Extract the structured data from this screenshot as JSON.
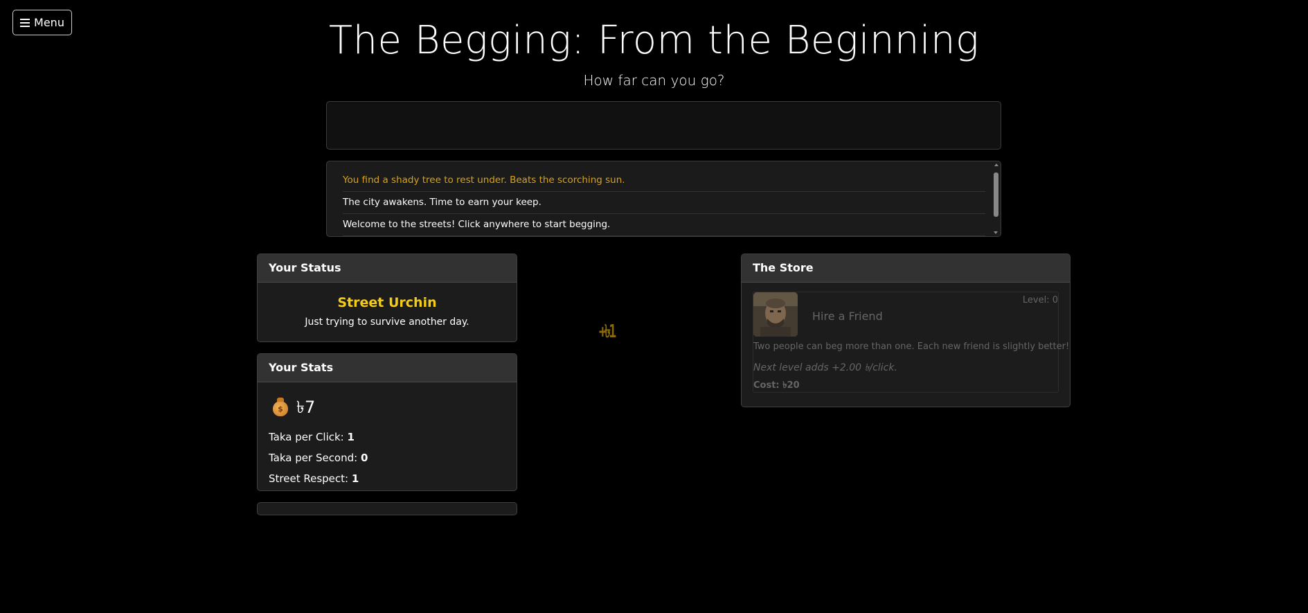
{
  "menu": {
    "label": "Menu",
    "icon": "hamburger-icon"
  },
  "header": {
    "title": "The Begging: From the Beginning",
    "subtitle": "How far can you go?"
  },
  "log": {
    "messages": [
      {
        "text": "You find a shady tree to rest under. Beats the scorching sun.",
        "color": "#d9a21b"
      },
      {
        "text": "The city awakens. Time to earn your keep.",
        "color": "#ffffff"
      },
      {
        "text": "Welcome to the streets! Click anywhere to start begging.",
        "color": "#ffffff"
      }
    ]
  },
  "status": {
    "heading": "Your Status",
    "rank": "Street Urchin",
    "description": "Just trying to survive another day.",
    "rank_color": "#f5cc15"
  },
  "stats": {
    "heading": "Your Stats",
    "money_icon": "money-bag-icon",
    "money": "৳7",
    "per_click_label": "Taka per Click:",
    "per_click_value": "1",
    "per_second_label": "Taka per Second:",
    "per_second_value": "0",
    "respect_label": "Street Respect:",
    "respect_value": "1"
  },
  "floating_gain": "+৳1",
  "store": {
    "heading": "The Store",
    "items": [
      {
        "name": "Hire a Friend",
        "level": "Level: 0",
        "description": "Two people can beg more than one. Each new friend is slightly better!",
        "next_level": "Next level adds +2.00 ৳/click.",
        "cost": "Cost: ৳20"
      }
    ]
  }
}
